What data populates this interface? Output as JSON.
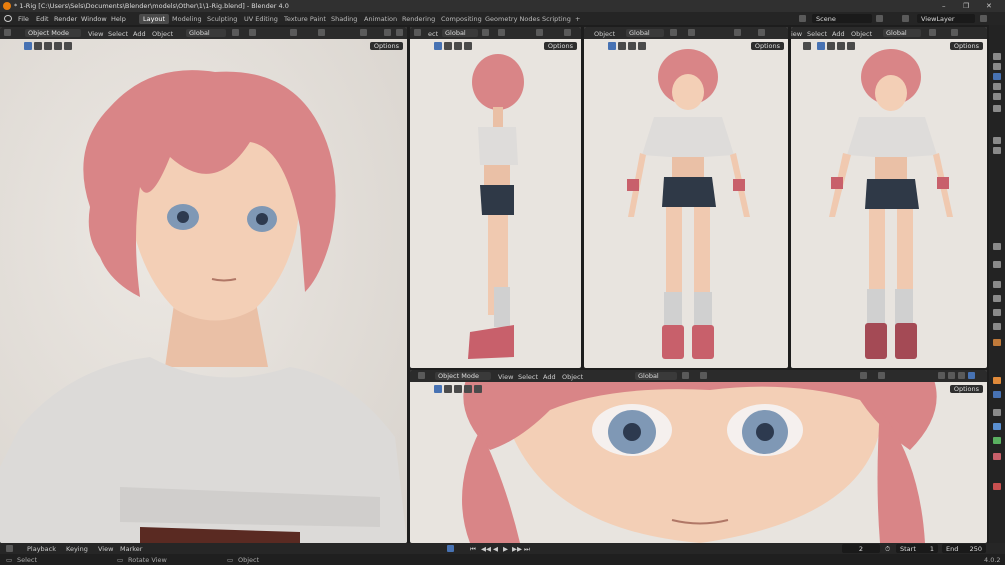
{
  "window": {
    "title": "* 1-Rig [C:\\Users\\Sels\\Documents\\Blender\\models\\Other\\1\\1-Rig.blend] - Blender 4.0",
    "controls": [
      "–",
      "❐",
      "✕"
    ]
  },
  "menu": [
    "File",
    "Edit",
    "Render",
    "Window",
    "Help"
  ],
  "workspaces": {
    "tabs": [
      "Layout",
      "Modeling",
      "Sculpting",
      "UV Editing",
      "Texture Paint",
      "Shading",
      "Animation",
      "Rendering",
      "Compositing",
      "Geometry Nodes",
      "Scripting"
    ],
    "active": "Layout",
    "add": "+"
  },
  "scene": {
    "name": "Scene",
    "view_layer": "ViewLayer"
  },
  "viewports": {
    "main": {
      "mode": "Object Mode",
      "menus": [
        "View",
        "Select",
        "Add",
        "Object"
      ],
      "orientation": "Global",
      "options": "Options"
    },
    "side": {
      "menus": [
        "ect"
      ],
      "orientation": "Global",
      "options": "Options"
    },
    "front": {
      "menus": [
        "Object"
      ],
      "orientation": "Global",
      "options": "Options"
    },
    "persp": {
      "menus": [
        "iew",
        "Select",
        "Add",
        "Object"
      ],
      "orientation": "Global",
      "options": "Options"
    },
    "closeup": {
      "mode": "Object Mode",
      "menus": [
        "View",
        "Select",
        "Add",
        "Object"
      ],
      "orientation": "Global",
      "options": "Options"
    }
  },
  "timeline": {
    "menus": [
      "Playback",
      "Keying",
      "View",
      "Marker"
    ],
    "frame_current": "2",
    "start_label": "Start",
    "start": "1",
    "end_label": "End",
    "end": "250"
  },
  "status": {
    "items": [
      "Select",
      "Rotate View",
      "Object"
    ],
    "version": "4.0.2"
  },
  "colors": {
    "hair": "#d98587",
    "skin": "#f3cfb6",
    "shirt": "#dedcda",
    "shorts": "#2f3947",
    "viewport_bg": "#e8e4df",
    "accent": "#4772b3"
  }
}
